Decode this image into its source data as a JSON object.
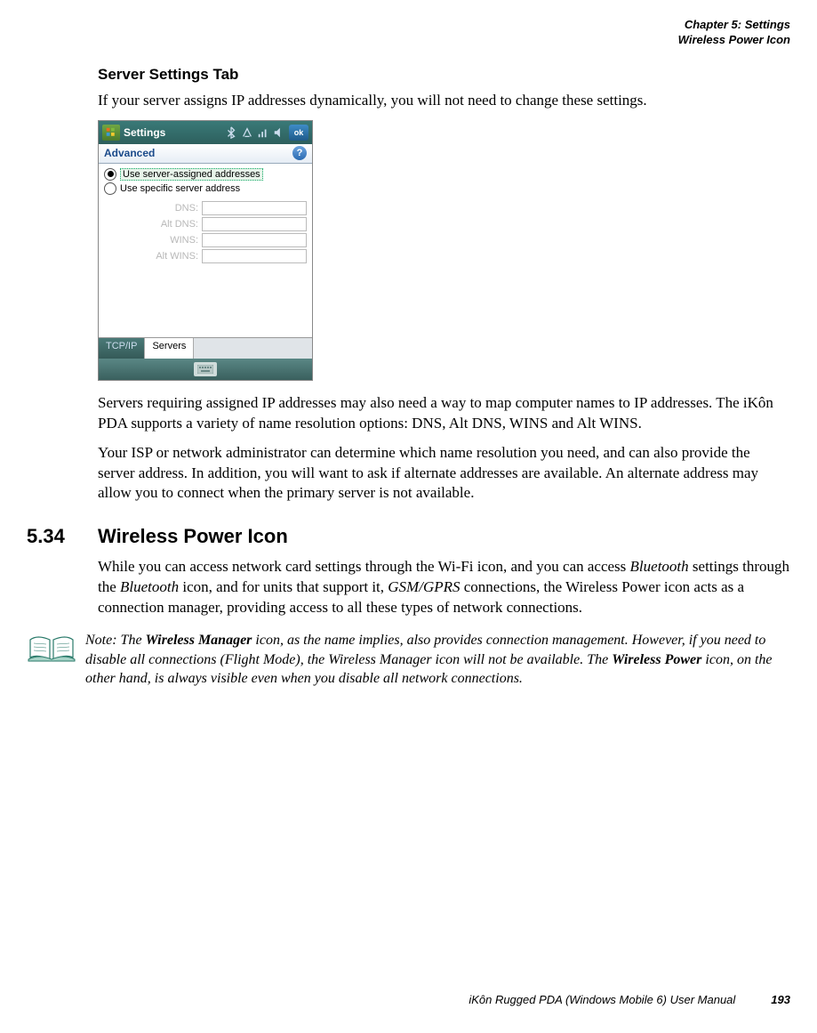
{
  "header": {
    "chapter": "Chapter 5: Settings",
    "section_ref": "Wireless Power Icon"
  },
  "server_tab": {
    "heading": "Server Settings Tab",
    "intro": "If your server assigns IP addresses dynamically, you will not need to change these settings.",
    "para2": "Servers requiring assigned IP addresses may also need a way to map computer names to IP addresses. The iKôn PDA supports a variety of name resolution options: DNS, Alt DNS, WINS and Alt WINS.",
    "para3": "Your ISP or network administrator can determine which name resolution you need, and can also provide the server address. In addition, you will want to ask if alternate addresses are available. An alternate address may allow you to connect when the primary server is not available."
  },
  "screenshot": {
    "title": "Settings",
    "ok": "ok",
    "tab_header": "Advanced",
    "radio1": "Use server-assigned addresses",
    "radio2": "Use specific server address",
    "fields": {
      "dns": "DNS:",
      "alt_dns": "Alt DNS:",
      "wins": "WINS:",
      "alt_wins": "Alt WINS:"
    },
    "bottom_tabs": {
      "tcpip": "TCP/IP",
      "servers": "Servers"
    }
  },
  "section534": {
    "number": "5.34",
    "title": "Wireless Power Icon",
    "para_parts": {
      "p1": "While you can access network card settings through the Wi-Fi icon, and you can access ",
      "bt": "Bluetooth",
      "p2": " settings through the ",
      "p3": " icon, and for units that support it, ",
      "gsm": "GSM/GPRS",
      "p4": " connections, the Wireless Power icon acts as a connection manager, providing access to all these types of network connections."
    }
  },
  "note": {
    "prefix": "Note: ",
    "t1": "The ",
    "b1": "Wireless Manager",
    "t2": " icon, as the name implies, also provides connection management. However, if you need to disable all connections (Flight Mode), the Wireless Manager icon will not be available. The ",
    "b2": "Wireless Power",
    "t3": " icon, on the other hand, is always visible even when you disable all network connections."
  },
  "footer": {
    "manual": "iKôn Rugged PDA (Windows Mobile 6) User Manual",
    "page": "193"
  }
}
